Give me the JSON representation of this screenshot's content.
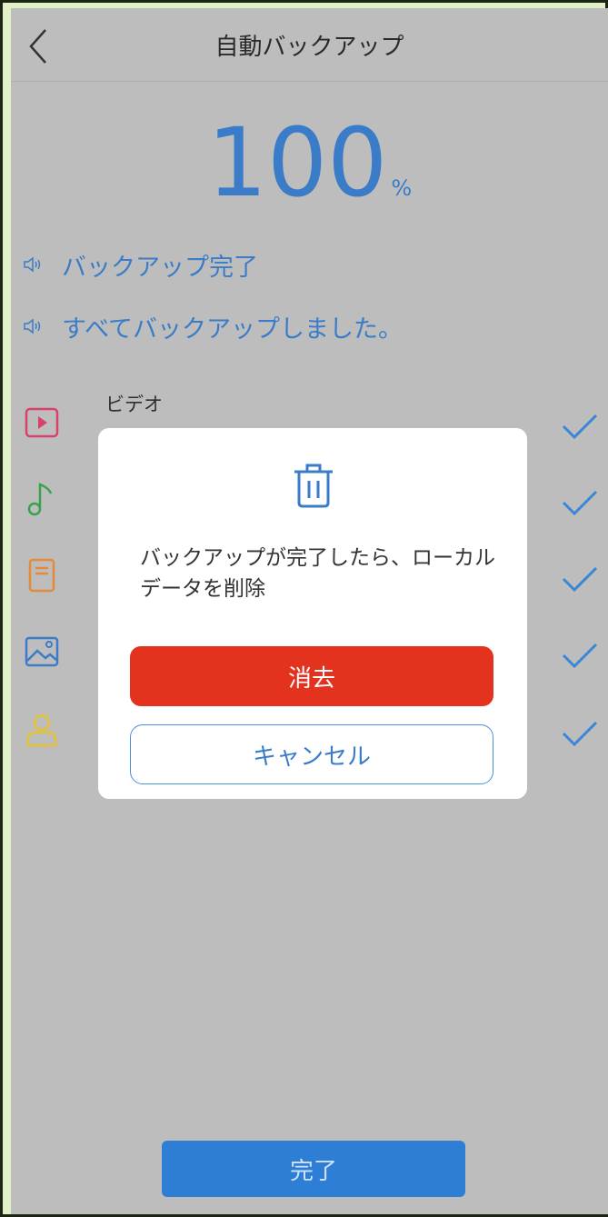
{
  "header": {
    "title": "自動バックアップ"
  },
  "progress": {
    "value": "100",
    "unit": "%"
  },
  "status": [
    "バックアップ完了",
    "すべてバックアップしました。"
  ],
  "categories": [
    {
      "label": "ビデオ",
      "icon": "video-icon",
      "color": "#d9416b"
    },
    {
      "icon": "music-icon",
      "color": "#39a348"
    },
    {
      "icon": "document-icon",
      "color": "#e58a37"
    },
    {
      "icon": "photo-icon",
      "color": "#3a7cc8"
    },
    {
      "icon": "contact-icon",
      "color": "#e4c233"
    }
  ],
  "dialog": {
    "message": "バックアップが完了したら、ローカルデータを削除",
    "delete_label": "消去",
    "cancel_label": "キャンセル"
  },
  "footer": {
    "done_label": "完了"
  },
  "colors": {
    "accent": "#3a7cc8",
    "danger": "#e3331f",
    "check": "#3a86d6"
  }
}
